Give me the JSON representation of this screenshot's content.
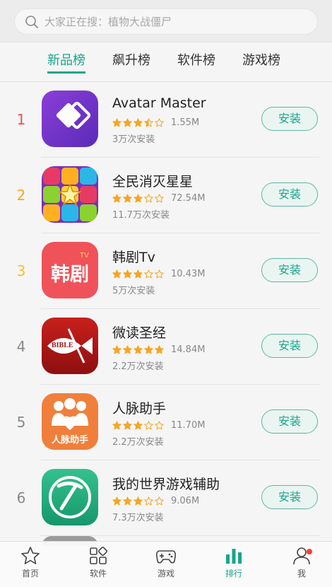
{
  "search": {
    "placeholder": "大家正在搜：植物大战僵尸"
  },
  "tabs": [
    {
      "label": "新品榜",
      "active": true
    },
    {
      "label": "飙升榜",
      "active": false
    },
    {
      "label": "软件榜",
      "active": false
    },
    {
      "label": "游戏榜",
      "active": false
    }
  ],
  "apps": [
    {
      "rank": "1",
      "rank_color": "#e8505b",
      "name": "Avatar Master",
      "rating": 3.5,
      "size": "1.55M",
      "installs": "3万次安装",
      "button": "安装",
      "icon": "avatar-master-icon"
    },
    {
      "rank": "2",
      "rank_color": "#f5a623",
      "name": "全民消灭星星",
      "rating": 3,
      "size": "72.54M",
      "installs": "11.7万次安装",
      "button": "安装",
      "icon": "popstar-game-icon"
    },
    {
      "rank": "3",
      "rank_color": "#f5c02c",
      "name": "韩剧Tv",
      "rating": 3,
      "size": "10.43M",
      "installs": "5万次安装",
      "button": "安装",
      "icon": "korean-drama-tv-icon",
      "icon_text": "韩剧",
      "icon_tag": "TV"
    },
    {
      "rank": "4",
      "rank_color": "#888888",
      "name": "微读圣经",
      "rating": 5,
      "size": "14.84M",
      "installs": "2.2万次安装",
      "button": "安装",
      "icon": "bible-icon",
      "icon_text": "BIBLE"
    },
    {
      "rank": "5",
      "rank_color": "#888888",
      "name": "人脉助手",
      "rating": 3,
      "size": "11.70M",
      "installs": "2.2万次安装",
      "button": "安装",
      "icon": "contacts-helper-icon",
      "icon_text": "人脉助手"
    },
    {
      "rank": "6",
      "rank_color": "#888888",
      "name": "我的世界游戏辅助",
      "rating": 3,
      "size": "9.06M",
      "installs": "7.3万次安装",
      "button": "安装",
      "icon": "minecraft-helper-icon"
    }
  ],
  "bottom_nav": [
    {
      "label": "首页",
      "icon": "star-icon",
      "active": false
    },
    {
      "label": "软件",
      "icon": "apps-grid-icon",
      "active": false
    },
    {
      "label": "游戏",
      "icon": "gamepad-icon",
      "active": false
    },
    {
      "label": "排行",
      "icon": "bar-chart-icon",
      "active": true
    },
    {
      "label": "我",
      "icon": "person-icon",
      "active": false,
      "badge": true
    }
  ],
  "colors": {
    "accent": "#19a58a",
    "star": "#f5a623",
    "badge": "#ff3b30"
  }
}
